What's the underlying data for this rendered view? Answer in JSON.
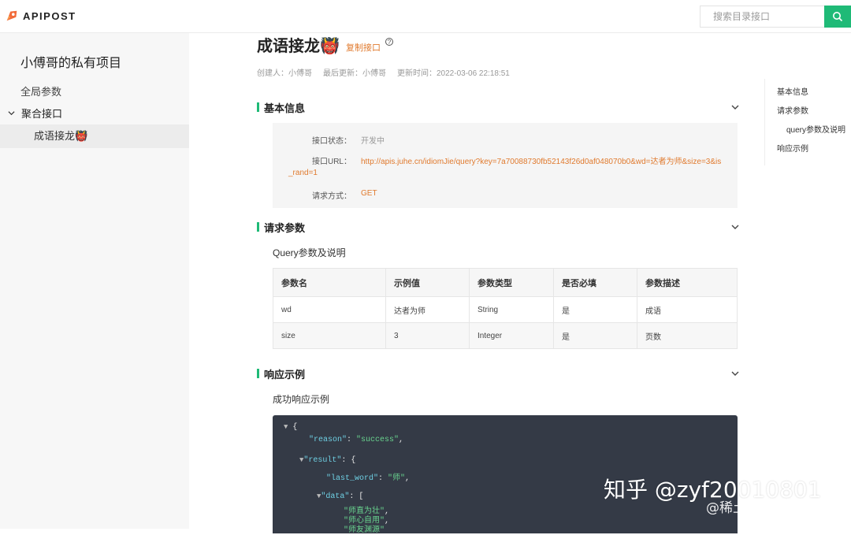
{
  "header": {
    "logo_text": "APIPOST",
    "search_placeholder": "搜索目录接口"
  },
  "sidebar": {
    "project_title": "小傅哥的私有项目",
    "global_params": "全局参数",
    "group_label": "聚合接口",
    "active_item": "成语接龙👹"
  },
  "api": {
    "title": "成语接龙👹",
    "copy_label": "复制接口",
    "help_glyph": "?",
    "creator": "创建人：小傅哥",
    "last_update": "最后更新：小傅哥",
    "update_time": "更新时间：2022-03-06 22:18:51"
  },
  "sections": {
    "basic_info": "基本信息",
    "request_params": "请求参数",
    "response_example": "响应示例"
  },
  "basic": {
    "status_label": "接口状态：",
    "status_value": "开发中",
    "url_label": "接口URL：",
    "url_value_line1": "http://apis.juhe.cn/idiomJie/query?key=7a70088730fb52143f26d0af048070b0&wd=达者为师&size=3&is",
    "url_value_line2": "_rand=1",
    "method_label": "请求方式：",
    "method_value": "GET"
  },
  "params": {
    "subtitle": "Query参数及说明",
    "headers": [
      "参数名",
      "示例值",
      "参数类型",
      "是否必填",
      "参数描述"
    ],
    "rows": [
      [
        "wd",
        "达者为师",
        "String",
        "是",
        "成语"
      ],
      [
        "size",
        "3",
        "Integer",
        "是",
        "页数"
      ]
    ]
  },
  "response": {
    "subtitle": "成功响应示例",
    "lines": {
      "open": "{",
      "reason_key": "\"reason\"",
      "reason_val": "\"success\"",
      "result_key": "\"result\"",
      "last_word_key": "\"last_word\"",
      "last_word_val": "\"师\"",
      "data_key": "\"data\"",
      "d1": "\"师直为壮\"",
      "d2": "\"师心自用\"",
      "d3": "\"师友渊源\""
    }
  },
  "toc": {
    "items": [
      "基本信息",
      "请求参数",
      "query参数及说明",
      "响应示例"
    ]
  },
  "watermark": {
    "main": "知乎 @zyf20010801",
    "sub": "@稀土掘金技术社区"
  },
  "colors": {
    "accent_green": "#1fba77",
    "link_orange": "#e07a2e",
    "code_bg": "#343a46"
  }
}
